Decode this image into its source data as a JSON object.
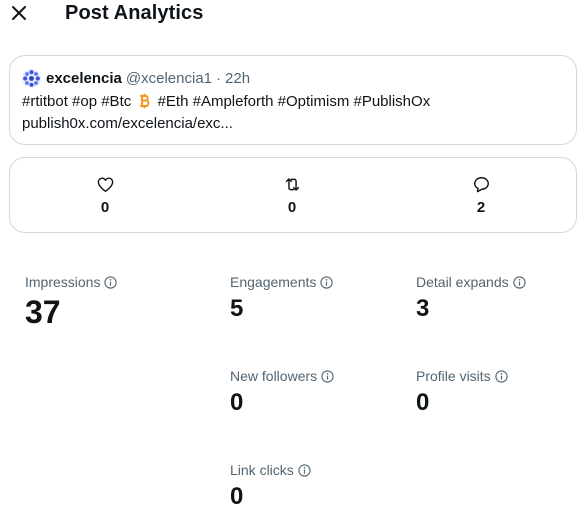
{
  "header": {
    "title": "Post Analytics",
    "close_icon": "close-icon"
  },
  "post": {
    "avatar_icon": "avatar-image",
    "author_name": "excelencia",
    "author_handle": "@xcelencia1",
    "separator": "·",
    "time": "22h",
    "text_before_icon": "#rtitbot #op #Btc",
    "inline_icon": "bitcoin-icon",
    "text_after_icon": "#Eth #Ampleforth  #Optimism #PublishOx",
    "link": "publish0x.com/excelencia/exc..."
  },
  "actions": {
    "likes": {
      "icon": "heart-icon",
      "count": "0"
    },
    "reposts": {
      "icon": "repost-icon",
      "count": "0"
    },
    "replies": {
      "icon": "reply-icon",
      "count": "2"
    }
  },
  "metrics": {
    "impressions": {
      "label": "Impressions",
      "value": "37"
    },
    "engagements": {
      "label": "Engagements",
      "value": "5"
    },
    "detail_expands": {
      "label": "Detail expands",
      "value": "3"
    },
    "new_followers": {
      "label": "New followers",
      "value": "0"
    },
    "profile_visits": {
      "label": "Profile visits",
      "value": "0"
    },
    "link_clicks": {
      "label": "Link clicks",
      "value": "0"
    }
  },
  "colors": {
    "text": "#0f1419",
    "secondary_text": "#536471",
    "border": "#cfd9de",
    "bitcoin": "#f7931a"
  }
}
